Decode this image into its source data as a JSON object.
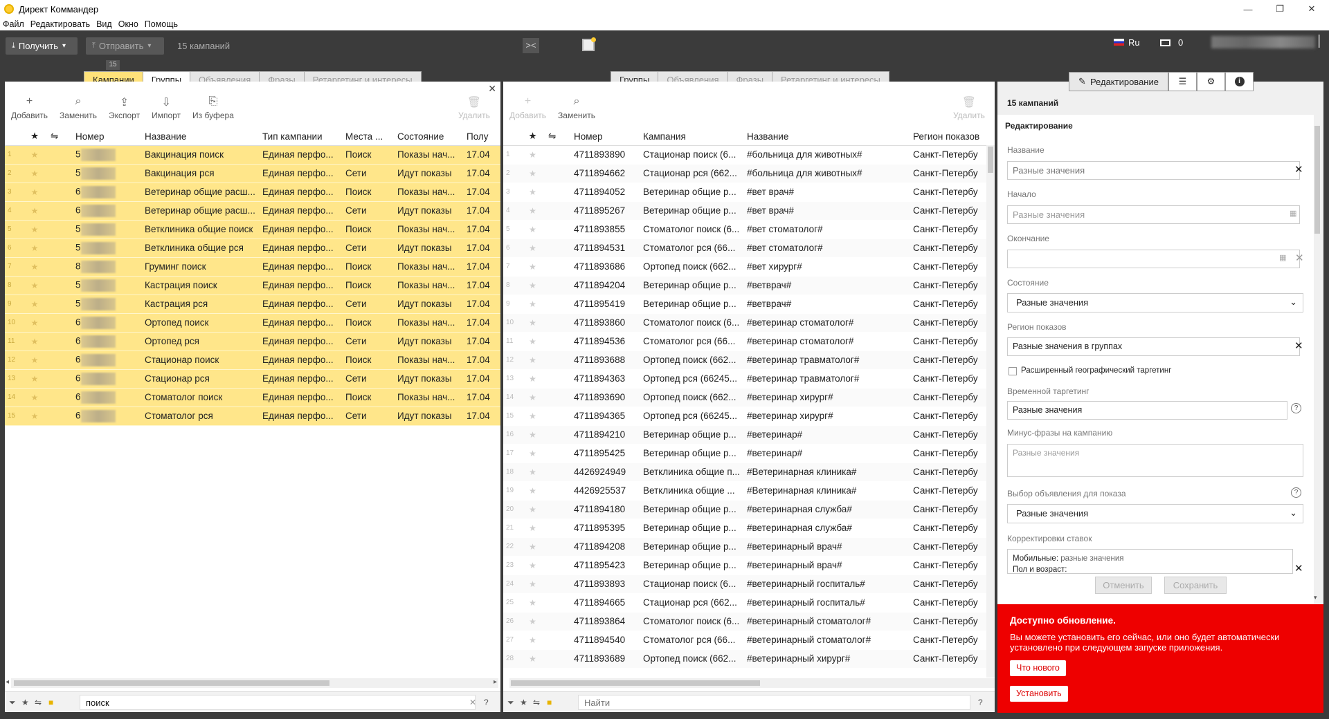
{
  "window": {
    "title": "Директ Коммандер",
    "min": "—",
    "max": "❐",
    "close": "✕"
  },
  "menu": [
    "Файл",
    "Редактировать",
    "Вид",
    "Окно",
    "Помощь"
  ],
  "toolbar": {
    "get": "Получить",
    "send": "Отправить",
    "count": "15 кампаний",
    "lang": "Ru",
    "notif": "0"
  },
  "left": {
    "tab_badge": "15",
    "tabs": [
      "Кампании",
      "Группы",
      "Объявления",
      "Фразы",
      "Ретаргетинг и интересы"
    ],
    "tools": [
      {
        "icon": "+",
        "label": "Добавить"
      },
      {
        "icon": "⌕",
        "label": "Заменить"
      },
      {
        "icon": "⇪",
        "label": "Экспорт"
      },
      {
        "icon": "⇩",
        "label": "Импорт"
      },
      {
        "icon": "⎘",
        "label": "Из буфера"
      }
    ],
    "delete": "Удалить",
    "headers": [
      "★",
      "⇋",
      "Номер",
      "Название",
      "Тип кампании",
      "Места ...",
      "Состояние",
      "Полу"
    ],
    "rows": [
      [
        "1",
        "5",
        "Вакцинация поиск",
        "Единая перфо...",
        "Поиск",
        "Показы нач...",
        "17.04"
      ],
      [
        "2",
        "5",
        "Вакцинация рся",
        "Единая перфо...",
        "Сети",
        "Идут показы",
        "17.04"
      ],
      [
        "3",
        "6",
        "Ветеринар общие расш...",
        "Единая перфо...",
        "Поиск",
        "Показы нач...",
        "17.04"
      ],
      [
        "4",
        "6",
        "Ветеринар общие расш...",
        "Единая перфо...",
        "Сети",
        "Идут показы",
        "17.04"
      ],
      [
        "5",
        "5",
        "Ветклиника общие поиск",
        "Единая перфо...",
        "Поиск",
        "Показы нач...",
        "17.04"
      ],
      [
        "6",
        "5",
        "Ветклиника общие рся",
        "Единая перфо...",
        "Сети",
        "Идут показы",
        "17.04"
      ],
      [
        "7",
        "8",
        "Груминг поиск",
        "Единая перфо...",
        "Поиск",
        "Показы нач...",
        "17.04"
      ],
      [
        "8",
        "5",
        "Кастрация поиск",
        "Единая перфо...",
        "Поиск",
        "Показы нач...",
        "17.04"
      ],
      [
        "9",
        "5",
        "Кастрация рся",
        "Единая перфо...",
        "Сети",
        "Идут показы",
        "17.04"
      ],
      [
        "10",
        "6",
        "Ортопед поиск",
        "Единая перфо...",
        "Поиск",
        "Показы нач...",
        "17.04"
      ],
      [
        "11",
        "6",
        "Ортопед рся",
        "Единая перфо...",
        "Сети",
        "Идут показы",
        "17.04"
      ],
      [
        "12",
        "6",
        "Стационар поиск",
        "Единая перфо...",
        "Поиск",
        "Показы нач...",
        "17.04"
      ],
      [
        "13",
        "6",
        "Стационар рся",
        "Единая перфо...",
        "Сети",
        "Идут показы",
        "17.04"
      ],
      [
        "14",
        "6",
        "Стоматолог поиск",
        "Единая перфо...",
        "Поиск",
        "Показы нач...",
        "17.04"
      ],
      [
        "15",
        "6",
        "Стоматолог рся",
        "Единая перфо...",
        "Сети",
        "Идут показы",
        "17.04"
      ]
    ],
    "filter_value": "поиск"
  },
  "middle": {
    "tabs": [
      "Группы",
      "Объявления",
      "Фразы",
      "Ретаргетинг и интересы"
    ],
    "tools": [
      {
        "icon": "+",
        "label": "Добавить"
      },
      {
        "icon": "⌕",
        "label": "Заменить"
      }
    ],
    "delete": "Удалить",
    "headers": [
      "★",
      "⇋",
      "Номер",
      "Кампания",
      "Название",
      "Регион показов"
    ],
    "rows": [
      [
        "1",
        "4711893890",
        "Стационар поиск (6...",
        "#больница для животных#",
        "Санкт-Петербу"
      ],
      [
        "2",
        "4711894662",
        "Стационар рся (662...",
        "#больница для животных#",
        "Санкт-Петербу"
      ],
      [
        "3",
        "4711894052",
        "Ветеринар общие р...",
        "#вет врач#",
        "Санкт-Петербу"
      ],
      [
        "4",
        "4711895267",
        "Ветеринар общие р...",
        "#вет врач#",
        "Санкт-Петербу"
      ],
      [
        "5",
        "4711893855",
        "Стоматолог поиск (6...",
        "#вет стоматолог#",
        "Санкт-Петербу"
      ],
      [
        "6",
        "4711894531",
        "Стоматолог рся (66...",
        "#вет стоматолог#",
        "Санкт-Петербу"
      ],
      [
        "7",
        "4711893686",
        "Ортопед поиск (662...",
        "#вет хирург#",
        "Санкт-Петербу"
      ],
      [
        "8",
        "4711894204",
        "Ветеринар общие р...",
        "#ветврач#",
        "Санкт-Петербу"
      ],
      [
        "9",
        "4711895419",
        "Ветеринар общие р...",
        "#ветврач#",
        "Санкт-Петербу"
      ],
      [
        "10",
        "4711893860",
        "Стоматолог поиск (6...",
        "#ветеринар стоматолог#",
        "Санкт-Петербу"
      ],
      [
        "11",
        "4711894536",
        "Стоматолог рся (66...",
        "#ветеринар стоматолог#",
        "Санкт-Петербу"
      ],
      [
        "12",
        "4711893688",
        "Ортопед поиск (662...",
        "#ветеринар травматолог#",
        "Санкт-Петербу"
      ],
      [
        "13",
        "4711894363",
        "Ортопед рся (66245...",
        "#ветеринар травматолог#",
        "Санкт-Петербу"
      ],
      [
        "14",
        "4711893690",
        "Ортопед поиск (662...",
        "#ветеринар хирург#",
        "Санкт-Петербу"
      ],
      [
        "15",
        "4711894365",
        "Ортопед рся (66245...",
        "#ветеринар хирург#",
        "Санкт-Петербу"
      ],
      [
        "16",
        "4711894210",
        "Ветеринар общие р...",
        "#ветеринар#",
        "Санкт-Петербу"
      ],
      [
        "17",
        "4711895425",
        "Ветеринар общие р...",
        "#ветеринар#",
        "Санкт-Петербу"
      ],
      [
        "18",
        "4426924949",
        "Ветклиника общие п...",
        "#Ветеринарная клиника#",
        "Санкт-Петербу"
      ],
      [
        "19",
        "4426925537",
        "Ветклиника общие ...",
        "#Ветеринарная клиника#",
        "Санкт-Петербу"
      ],
      [
        "20",
        "4711894180",
        "Ветеринар общие р...",
        "#ветеринарная служба#",
        "Санкт-Петербу"
      ],
      [
        "21",
        "4711895395",
        "Ветеринар общие р...",
        "#ветеринарная служба#",
        "Санкт-Петербу"
      ],
      [
        "22",
        "4711894208",
        "Ветеринар общие р...",
        "#ветеринарный врач#",
        "Санкт-Петербу"
      ],
      [
        "23",
        "4711895423",
        "Ветеринар общие р...",
        "#ветеринарный врач#",
        "Санкт-Петербу"
      ],
      [
        "24",
        "4711893893",
        "Стационар поиск (6...",
        "#ветеринарный госпиталь#",
        "Санкт-Петербу"
      ],
      [
        "25",
        "4711894665",
        "Стационар рся (662...",
        "#ветеринарный госпиталь#",
        "Санкт-Петербу"
      ],
      [
        "26",
        "4711893864",
        "Стоматолог поиск (6...",
        "#ветеринарный стоматолог#",
        "Санкт-Петербу"
      ],
      [
        "27",
        "4711894540",
        "Стоматолог рся (66...",
        "#ветеринарный стоматолог#",
        "Санкт-Петербу"
      ],
      [
        "28",
        "4711893689",
        "Ортопед поиск (662...",
        "#ветеринарный хирург#",
        "Санкт-Петербу"
      ]
    ],
    "filter_placeholder": "Найти"
  },
  "right": {
    "tab_edit": "Редактирование",
    "count": "15 кампаний",
    "section": "Редактирование",
    "name_lbl": "Название",
    "name_ph": "Разные значения",
    "start_lbl": "Начало",
    "start_ph": "Разные значения",
    "end_lbl": "Окончание",
    "state_lbl": "Состояние",
    "state_val": "Разные значения",
    "region_lbl": "Регион показов",
    "region_val": "Разные значения в группах",
    "geo_lbl": "Расширенный географический таргетинг",
    "time_lbl": "Временной таргетинг",
    "time_val": "Разные значения",
    "minus_lbl": "Минус-фразы на кампанию",
    "minus_ph": "Разные значения",
    "adsel_lbl": "Выбор объявления для показа",
    "adsel_val": "Разные значения",
    "bids_lbl": "Корректировки ставок",
    "bids_key": "Мобильные:",
    "bids_val": "разные значения",
    "bids_more": "Пол и возраст:",
    "cancel": "Отменить",
    "save": "Сохранить"
  },
  "update": {
    "title": "Доступно обновление.",
    "text": "Вы можете установить его сейчас, или оно будет автоматически установлено при следующем запуске приложения.",
    "whatsnew": "Что нового",
    "install": "Установить"
  }
}
